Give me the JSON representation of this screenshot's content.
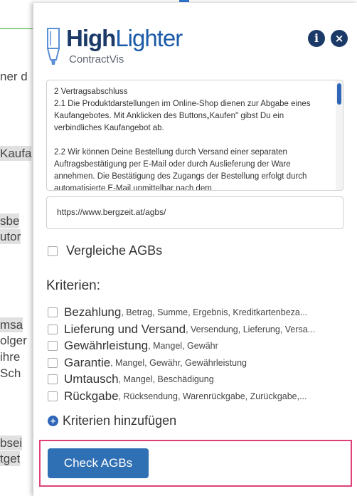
{
  "background_page": {
    "fragments": [
      "ner d",
      "Kaufa",
      "sbe",
      "utor",
      "msa",
      "olger",
      "ihre",
      "Sch",
      "bsei",
      "tget"
    ]
  },
  "header": {
    "logo_high": "High",
    "logo_lighter": "Lighter",
    "logo_sub": "ContractVis",
    "info_icon_glyph": "i",
    "close_icon_glyph": "×"
  },
  "contract_text": {
    "paragraphs": [
      "2 Vertragsabschluss\n2.1 Die Produktdarstellungen im Online-Shop dienen zur Abgabe eines Kaufangebotes. Mit Anklicken des Buttons„Kaufen\" gibst Du ein verbindliches Kaufangebot ab.",
      "2.2 Wir können Deine Bestellung durch Versand einer separaten Auftragsbestätigung per E-Mail oder durch Auslieferung der Ware annehmen. Die Bestätigung des Zugangs der Bestellung erfolgt durch automatisierte E-Mail unmittelbar nach dem"
    ]
  },
  "url_field": {
    "value": "https://www.bergzeit.at/agbs/"
  },
  "compare_label": "Vergleiche AGBs",
  "criteria_title": "Kriterien:",
  "criteria": [
    {
      "name": "Bezahlung",
      "keywords": ", Betrag, Summe, Ergebnis, Kreditkartenbeza..."
    },
    {
      "name": "Lieferung und Versand",
      "keywords": ", Versendung, Lieferung, Versa..."
    },
    {
      "name": "Gewährleistung",
      "keywords": ", Mangel, Gewähr"
    },
    {
      "name": "Garantie",
      "keywords": ", Mangel, Gewähr, Gewährleistung"
    },
    {
      "name": "Umtausch",
      "keywords": ", Mangel, Beschädigung"
    },
    {
      "name": "Rückgabe",
      "keywords": ", Rücksendung, Warenrückgabe, Zurückgabe,..."
    }
  ],
  "add_criteria_label": "Kriterien hinzufügen",
  "check_button_label": "Check AGBs",
  "colors": {
    "brand_dark": "#1b3a68",
    "brand_blue": "#1b5aa8",
    "button_blue": "#2f6fb4",
    "highlight_frame": "#e0407a"
  }
}
